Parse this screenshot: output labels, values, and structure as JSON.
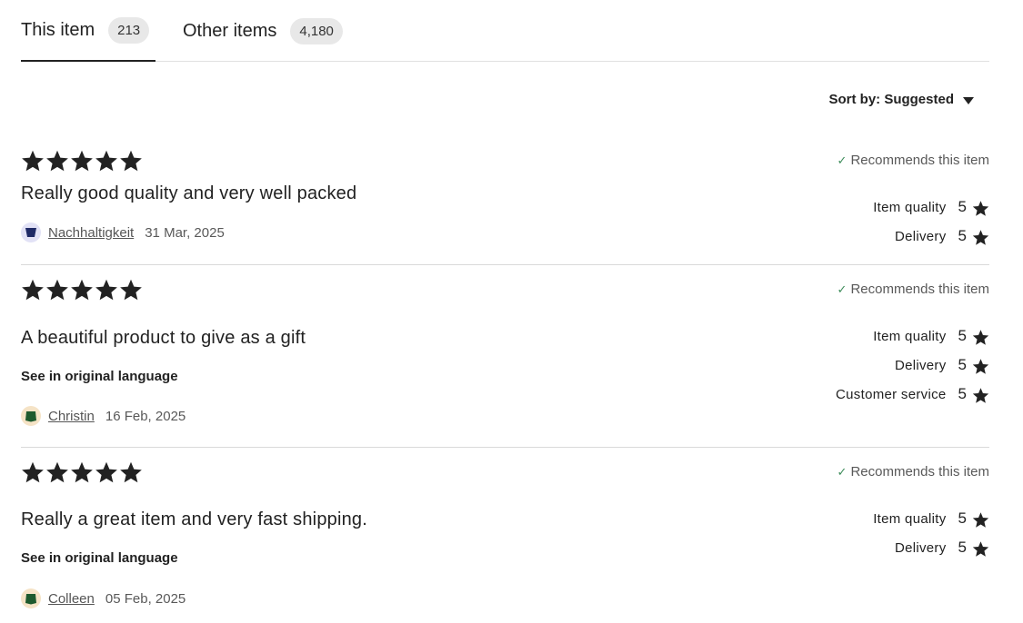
{
  "tabs": [
    {
      "label": "This item",
      "count": "213",
      "active": true
    },
    {
      "label": "Other items",
      "count": "4,180",
      "active": false
    }
  ],
  "sort": {
    "label": "Sort by: Suggested"
  },
  "reviews": [
    {
      "stars": 5,
      "text": "Really good quality and very well packed",
      "see_original": "",
      "author": "Nachhaltigkeit",
      "date": "31 Mar, 2025",
      "recommends": "Recommends this item",
      "ratings": [
        {
          "label": "Item quality",
          "value": "5"
        },
        {
          "label": "Delivery",
          "value": "5"
        }
      ]
    },
    {
      "stars": 5,
      "text": "A beautiful product to give as a gift",
      "see_original": "See in original language",
      "author": "Christin",
      "date": "16 Feb, 2025",
      "recommends": "Recommends this item",
      "ratings": [
        {
          "label": "Item quality",
          "value": "5"
        },
        {
          "label": "Delivery",
          "value": "5"
        },
        {
          "label": "Customer service",
          "value": "5"
        }
      ]
    },
    {
      "stars": 5,
      "text": "Really a great item and very fast shipping.",
      "see_original": "See in original language",
      "author": "Colleen",
      "date": "05 Feb, 2025",
      "recommends": "Recommends this item",
      "ratings": [
        {
          "label": "Item quality",
          "value": "5"
        },
        {
          "label": "Delivery",
          "value": "5"
        }
      ]
    }
  ],
  "icons": {
    "star": "star-icon",
    "check": "check-icon",
    "caret": "caret-down-icon"
  },
  "colors": {
    "text": "#222222",
    "muted": "#595959",
    "check": "#3d8c5a",
    "badge_bg": "#e8e8e8",
    "divider": "#d9d9d9"
  }
}
